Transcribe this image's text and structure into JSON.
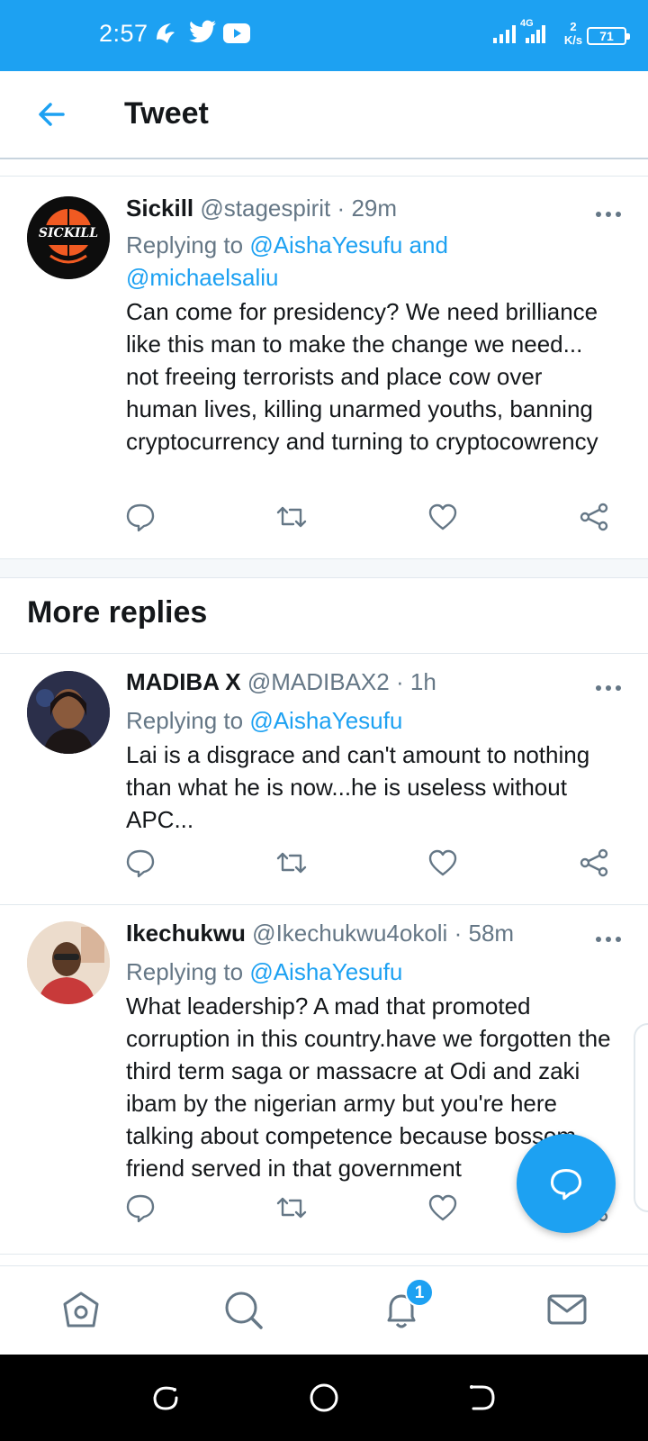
{
  "status_bar": {
    "time": "2:57",
    "network_type": "4G",
    "speed_value": "2",
    "speed_unit": "K/s",
    "battery": "71",
    "app_icons": [
      "wifi-ish-app-icon",
      "twitter-icon",
      "youtube-icon"
    ]
  },
  "header": {
    "title": "Tweet",
    "back_icon": "arrow-left-icon"
  },
  "section": {
    "more_replies": "More replies"
  },
  "tweets": [
    {
      "name": "Sickill",
      "handle": "@stagespirit",
      "separator": "·",
      "time": "29m",
      "replying_prefix": "Replying to",
      "replying_mentions_line1": "@AishaYesufu and",
      "replying_mentions_line2": "@michaelsaliu",
      "text": "Can come for presidency? We need brilliance like this man to make the change we need... not freeing terrorists and place cow over human lives, killing unarmed youths, banning cryptocurrency and turning to cryptocowrency",
      "avatar_text": "SICKILL"
    },
    {
      "name": "MADIBA X",
      "handle": "@MADIBAX2",
      "separator": "·",
      "time": "1h",
      "replying_prefix": "Replying to",
      "replying_mentions_line1": "@AishaYesufu",
      "text": "Lai is a disgrace and can't amount to nothing than what he is now...he is useless without APC..."
    },
    {
      "name": "Ikechukwu",
      "handle": "@Ikechukwu4okoli",
      "separator": "·",
      "time": "58m",
      "replying_prefix": "Replying to",
      "replying_mentions_line1": "@AishaYesufu",
      "text": "What leadership? A mad that promoted corruption in this country.have we forgotten the third term saga or massacre at Odi and zaki ibam by the nigerian army but you're here talking about competence because bossom friend served in that government"
    }
  ],
  "bottom_nav": {
    "items": [
      "home-icon",
      "search-icon",
      "notifications-icon",
      "messages-icon"
    ],
    "notification_badge": "1"
  },
  "colors": {
    "accent": "#1da1f2",
    "text": "#14171a",
    "muted": "#657786",
    "divider": "#e1e8ed"
  }
}
